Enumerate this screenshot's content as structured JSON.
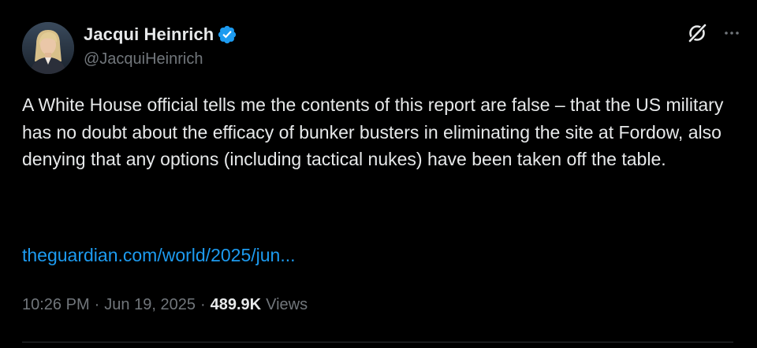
{
  "author": {
    "display_name": "Jacqui Heinrich",
    "handle": "@JacquiHeinrich",
    "verified": true,
    "verified_color": "#1d9bf0",
    "avatar_icon": "profile-photo"
  },
  "header_actions": {
    "grok_icon": "grok-icon",
    "more_icon": "more-horizontal-icon"
  },
  "tweet": {
    "text": "A White House official tells me the contents of this report are false – that the US military has no doubt about the efficacy of bunker busters in eliminating the site at Fordow, also denying that any options (including tactical nukes) have been taken off the table.",
    "link_text": "theguardian.com/world/2025/jun..."
  },
  "meta": {
    "time": "10:26 PM",
    "separator": "·",
    "date": "Jun 19, 2025",
    "views_count": "489.9K",
    "views_label": "Views"
  },
  "colors": {
    "background": "#000000",
    "text_primary": "#e7e9ea",
    "text_secondary": "#71767b",
    "link": "#1d9bf0",
    "divider": "#2f3336"
  }
}
